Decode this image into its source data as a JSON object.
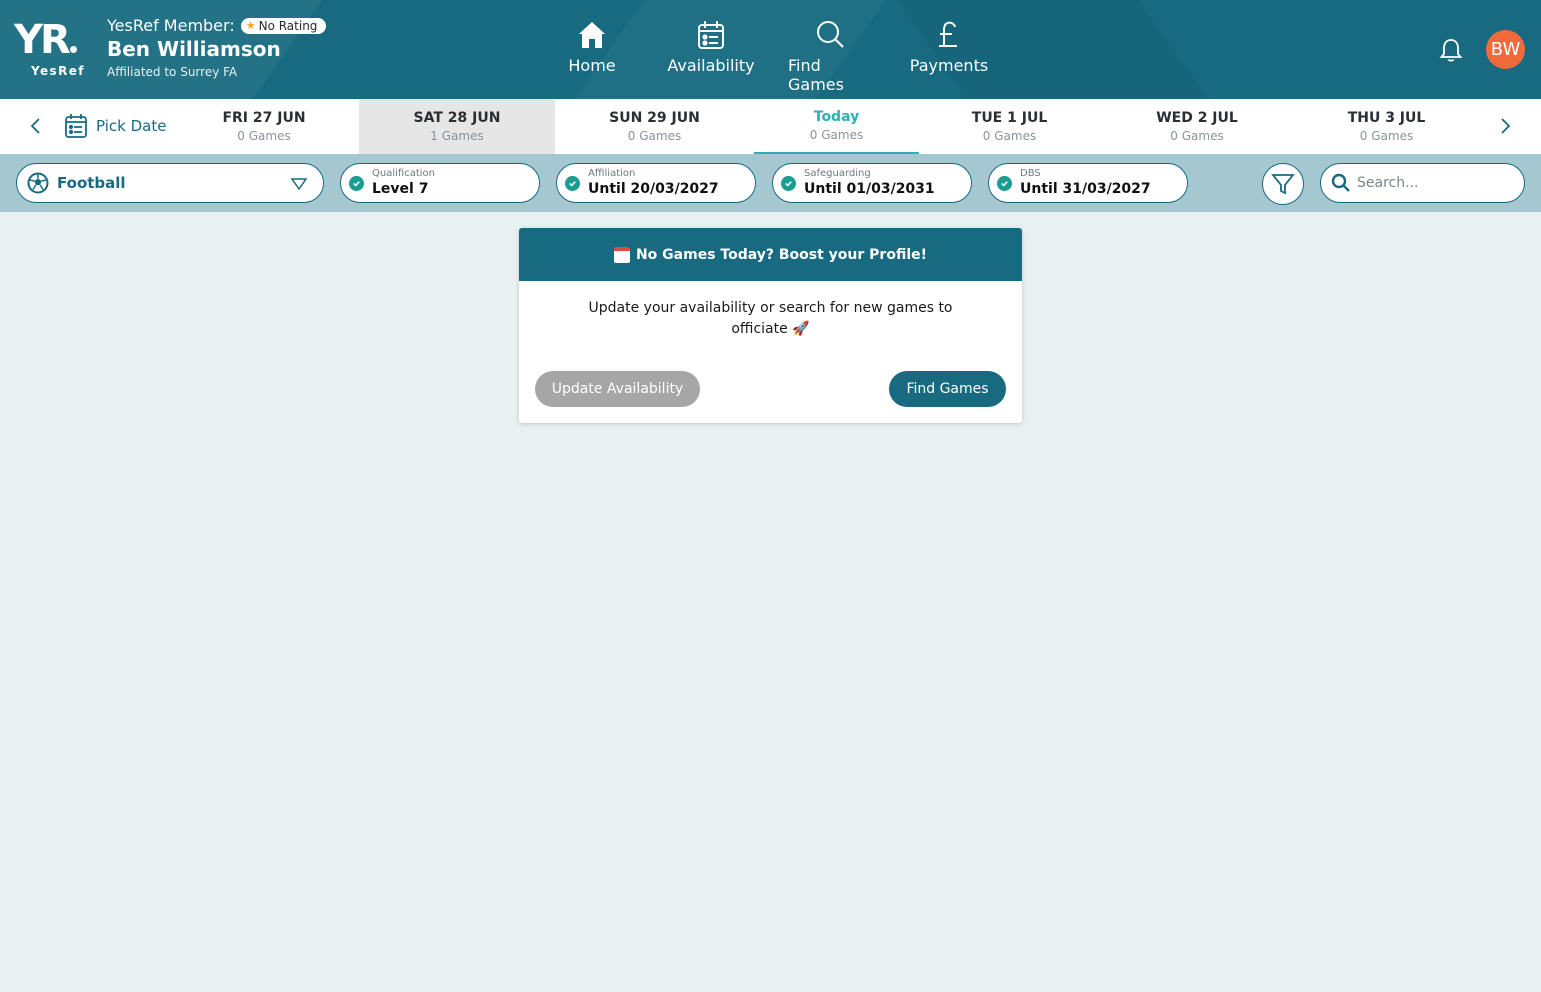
{
  "header": {
    "logo_mark": "YR",
    "logo_text": "YesRef",
    "member_label": "YesRef Member:",
    "rating": "No Rating",
    "user_name": "Ben Williamson",
    "affiliation": "Affiliated to Surrey FA",
    "avatar_initials": "BW",
    "avatar_color": "#f06a3b",
    "brand_color": "#176a80"
  },
  "nav": {
    "home": "Home",
    "availability": "Availability",
    "find_games": "Find Games",
    "payments": "Payments"
  },
  "datebar": {
    "pick_date": "Pick Date",
    "days": [
      {
        "title": "FRI 27 JUN",
        "count": "0 Games"
      },
      {
        "title": "SAT 28 JUN",
        "count": "1 Games"
      },
      {
        "title": "SUN 29 JUN",
        "count": "0 Games"
      },
      {
        "title": "Today",
        "count": "0 Games"
      },
      {
        "title": "TUE 1 JUL",
        "count": "0 Games"
      },
      {
        "title": "WED 2 JUL",
        "count": "0 Games"
      },
      {
        "title": "THU 3 JUL",
        "count": "0 Games"
      }
    ],
    "selected_index": 1,
    "today_index": 3
  },
  "filters": {
    "sport": "Football",
    "chips": [
      {
        "label": "Qualification",
        "value": "Level 7"
      },
      {
        "label": "Affiliation",
        "value": "Until 20/03/2027"
      },
      {
        "label": "Safeguarding",
        "value": "Until 01/03/2031"
      },
      {
        "label": "DBS",
        "value": "Until 31/03/2027"
      }
    ],
    "search_placeholder": "Search..."
  },
  "card": {
    "title": "No Games Today? Boost your Profile!",
    "message_line1": "Update your availability or search for new games to",
    "message_line2": "officiate",
    "update_button": "Update Availability",
    "find_button": "Find Games"
  }
}
